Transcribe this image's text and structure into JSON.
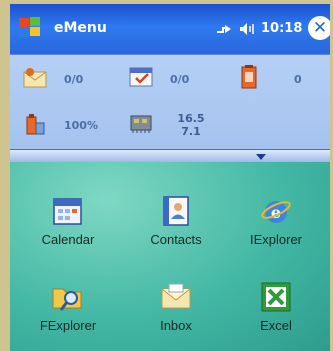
{
  "titlebar": {
    "title": "eMenu",
    "time": "10:18",
    "close_label": "✕"
  },
  "status": {
    "sms": "0/0",
    "tasks": "0/0",
    "battery_right": "0",
    "battery_percent": "100%",
    "memory_top": "16.5",
    "memory_bottom": "7.1"
  },
  "apps": [
    {
      "label": "Calendar"
    },
    {
      "label": "Contacts"
    },
    {
      "label": "IExplorer"
    },
    {
      "label": "FExplorer"
    },
    {
      "label": "Inbox"
    },
    {
      "label": "Excel"
    }
  ]
}
